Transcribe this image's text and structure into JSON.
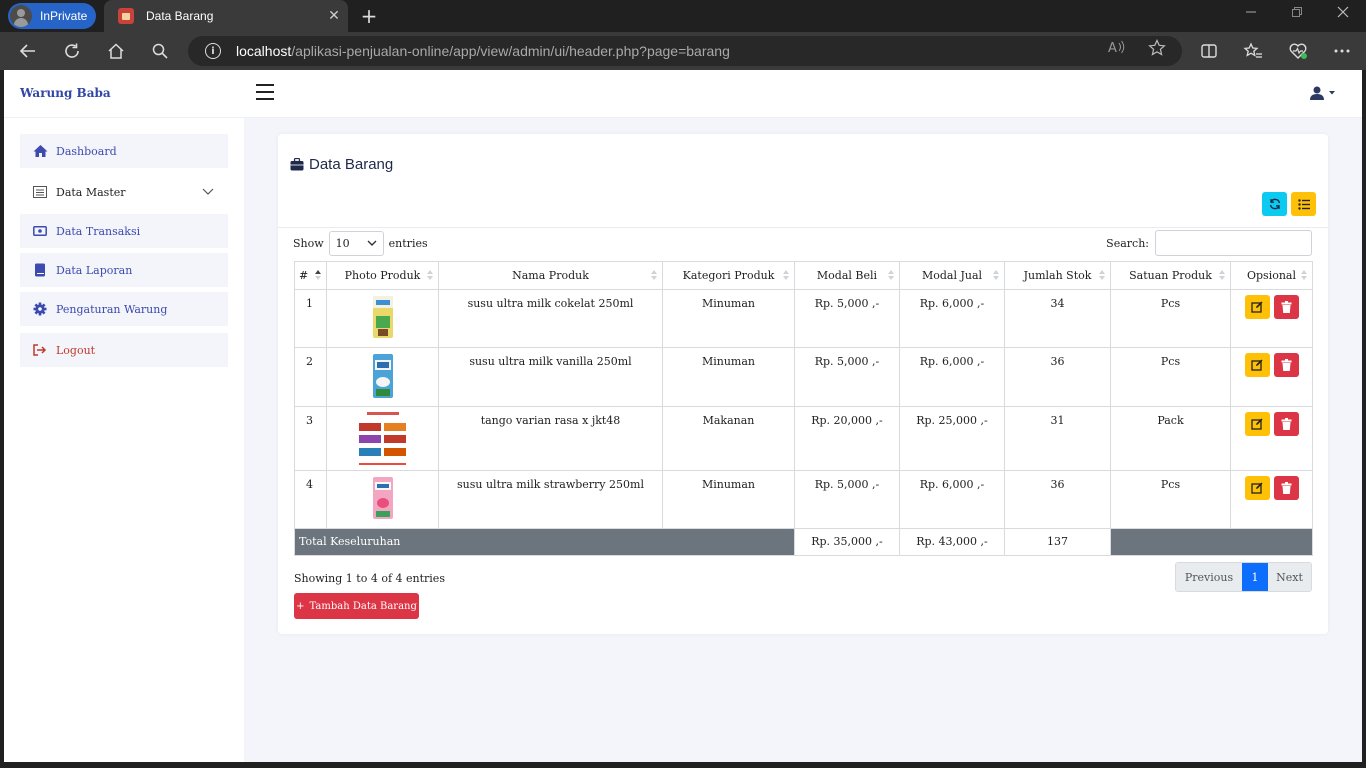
{
  "browser": {
    "inprivate_label": "InPrivate",
    "tab_title": "Data Barang",
    "tab_close": "✕",
    "new_tab": "+",
    "url_host": "localhost",
    "url_path": "/aplikasi-penjualan-online/app/view/admin/ui/header.php?page=barang"
  },
  "app": {
    "brand": "Warung Baba"
  },
  "sidebar": {
    "items": [
      {
        "label": "Dashboard",
        "icon": "home-icon"
      },
      {
        "label": "Data Master",
        "icon": "list-icon"
      },
      {
        "label": "Data Transaksi",
        "icon": "money-icon"
      },
      {
        "label": "Data Laporan",
        "icon": "book-icon"
      },
      {
        "label": "Pengaturan Warung",
        "icon": "gear-icon"
      },
      {
        "label": "Logout",
        "icon": "logout-icon"
      }
    ]
  },
  "card": {
    "title": "Data Barang"
  },
  "datatable": {
    "show_label": "Show",
    "entries_label": "entries",
    "page_length": "10",
    "search_label": "Search:",
    "columns": [
      "#",
      "Photo Produk",
      "Nama Produk",
      "Kategori Produk",
      "Modal Beli",
      "Modal Jual",
      "Jumlah Stok",
      "Satuan Produk",
      "Opsional"
    ],
    "rows": [
      {
        "no": "1",
        "nama": "susu ultra milk cokelat 250ml",
        "kategori": "Minuman",
        "modal_beli": "Rp. 5,000 ,-",
        "modal_jual": "Rp. 6,000 ,-",
        "stok": "34",
        "satuan": "Pcs"
      },
      {
        "no": "2",
        "nama": "susu ultra milk vanilla 250ml",
        "kategori": "Minuman",
        "modal_beli": "Rp. 5,000 ,-",
        "modal_jual": "Rp. 6,000 ,-",
        "stok": "36",
        "satuan": "Pcs"
      },
      {
        "no": "3",
        "nama": "tango varian rasa x jkt48",
        "kategori": "Makanan",
        "modal_beli": "Rp. 20,000 ,-",
        "modal_jual": "Rp. 25,000 ,-",
        "stok": "31",
        "satuan": "Pack"
      },
      {
        "no": "4",
        "nama": "susu ultra milk strawberry 250ml",
        "kategori": "Minuman",
        "modal_beli": "Rp. 5,000 ,-",
        "modal_jual": "Rp. 6,000 ,-",
        "stok": "36",
        "satuan": "Pcs"
      }
    ],
    "total": {
      "label": "Total Keseluruhan",
      "modal_beli": "Rp. 35,000 ,-",
      "modal_jual": "Rp. 43,000 ,-",
      "stok": "137"
    },
    "info": "Showing 1 to 4 of 4 entries",
    "pagination": {
      "previous": "Previous",
      "current": "1",
      "next": "Next"
    }
  },
  "buttons": {
    "add": "Tambah Data Barang",
    "add_prefix": "+"
  },
  "colors": {
    "brand": "#3146a5",
    "info": "#0dcaf0",
    "warning": "#ffc107",
    "danger": "#dc3545",
    "primary": "#0d6efd",
    "total_row": "#6c757d"
  }
}
